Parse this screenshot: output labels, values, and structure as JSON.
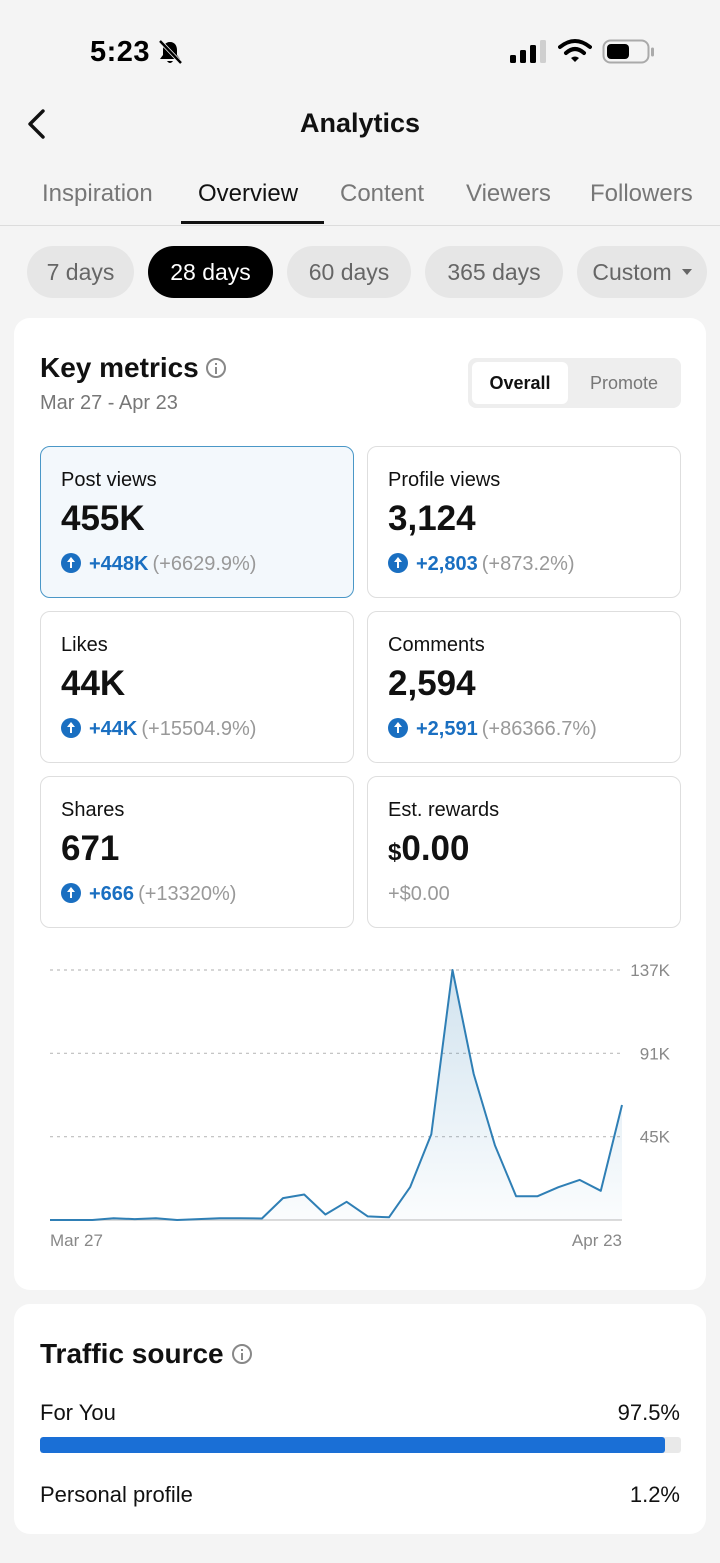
{
  "status_bar": {
    "time": "5:23"
  },
  "header": {
    "title": "Analytics"
  },
  "tabs": [
    {
      "label": "Inspiration"
    },
    {
      "label": "Overview",
      "active": true
    },
    {
      "label": "Content"
    },
    {
      "label": "Viewers"
    },
    {
      "label": "Followers"
    }
  ],
  "ranges": [
    {
      "label": "7 days"
    },
    {
      "label": "28 days",
      "active": true
    },
    {
      "label": "60 days"
    },
    {
      "label": "365 days"
    },
    {
      "label": "Custom"
    }
  ],
  "key_metrics": {
    "title": "Key metrics",
    "date_range": "Mar 27 - Apr 23",
    "toggle": {
      "overall": "Overall",
      "promote": "Promote",
      "selected": "Overall"
    },
    "metrics": [
      {
        "label": "Post views",
        "value": "455K",
        "delta": "+448K",
        "pct": "(+6629.9%)",
        "selected": true
      },
      {
        "label": "Profile views",
        "value": "3,124",
        "delta": "+2,803",
        "pct": "(+873.2%)"
      },
      {
        "label": "Likes",
        "value": "44K",
        "delta": "+44K",
        "pct": "(+15504.9%)"
      },
      {
        "label": "Comments",
        "value": "2,594",
        "delta": "+2,591",
        "pct": "(+86366.7%)"
      },
      {
        "label": "Shares",
        "value": "671",
        "delta": "+666",
        "pct": "(+13320%)"
      },
      {
        "label": "Est. rewards",
        "currency": "$",
        "value": "0.00",
        "delta": "+$0.00"
      }
    ]
  },
  "chart_data": {
    "type": "area",
    "series": [
      {
        "values": [
          0,
          0,
          0,
          1000,
          500,
          1000,
          0,
          500,
          1000,
          1000,
          800,
          12000,
          14000,
          3000,
          10000,
          2000,
          1500,
          18000,
          47000,
          137000,
          80000,
          41000,
          13000,
          13000,
          18000,
          22000,
          16000,
          63000
        ]
      }
    ],
    "x_labels": [
      "Mar 27",
      "Apr 23"
    ],
    "y_ticks": [
      "45K",
      "91K",
      "137K"
    ],
    "ylim": [
      0,
      137000
    ],
    "grid": true,
    "color": "#2f7fb5"
  },
  "traffic_source": {
    "title": "Traffic source",
    "rows": [
      {
        "label": "For You",
        "value": "97.5%",
        "fraction": 0.975
      },
      {
        "label": "Personal profile",
        "value": "1.2%",
        "fraction": 0.012
      }
    ]
  }
}
